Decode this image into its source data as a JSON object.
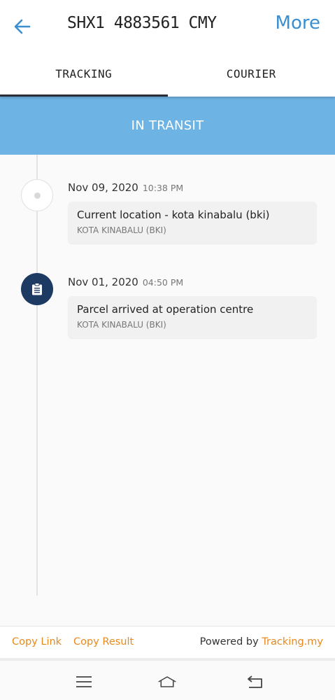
{
  "header": {
    "title": "SHX1 4883561 CMY",
    "more_label": "More",
    "back_icon": "arrow-left-icon",
    "accent_color": "#3b8fd0"
  },
  "tabs": [
    {
      "label": "TRACKING",
      "active": true
    },
    {
      "label": "COURIER",
      "active": false
    }
  ],
  "status": {
    "label": "IN TRANSIT",
    "color": "#6db3e4"
  },
  "events": [
    {
      "date": "Nov 09, 2020",
      "time": "10:38 PM",
      "description": "Current location - kota kinabalu (bki)",
      "location": "KOTA KINABALU (BKI)",
      "icon": "dot-icon"
    },
    {
      "date": "Nov 01, 2020",
      "time": "04:50 PM",
      "description": "Parcel arrived at operation centre",
      "location": "KOTA KINABALU (BKI)",
      "icon": "clipboard-icon"
    }
  ],
  "footer": {
    "copy_link": "Copy Link",
    "copy_result": "Copy Result",
    "powered_by": "Powered by",
    "brand": "Tracking.my",
    "link_color": "#e8891c"
  },
  "system_nav": {
    "icons": [
      "menu-icon",
      "home-icon",
      "back-icon"
    ]
  }
}
